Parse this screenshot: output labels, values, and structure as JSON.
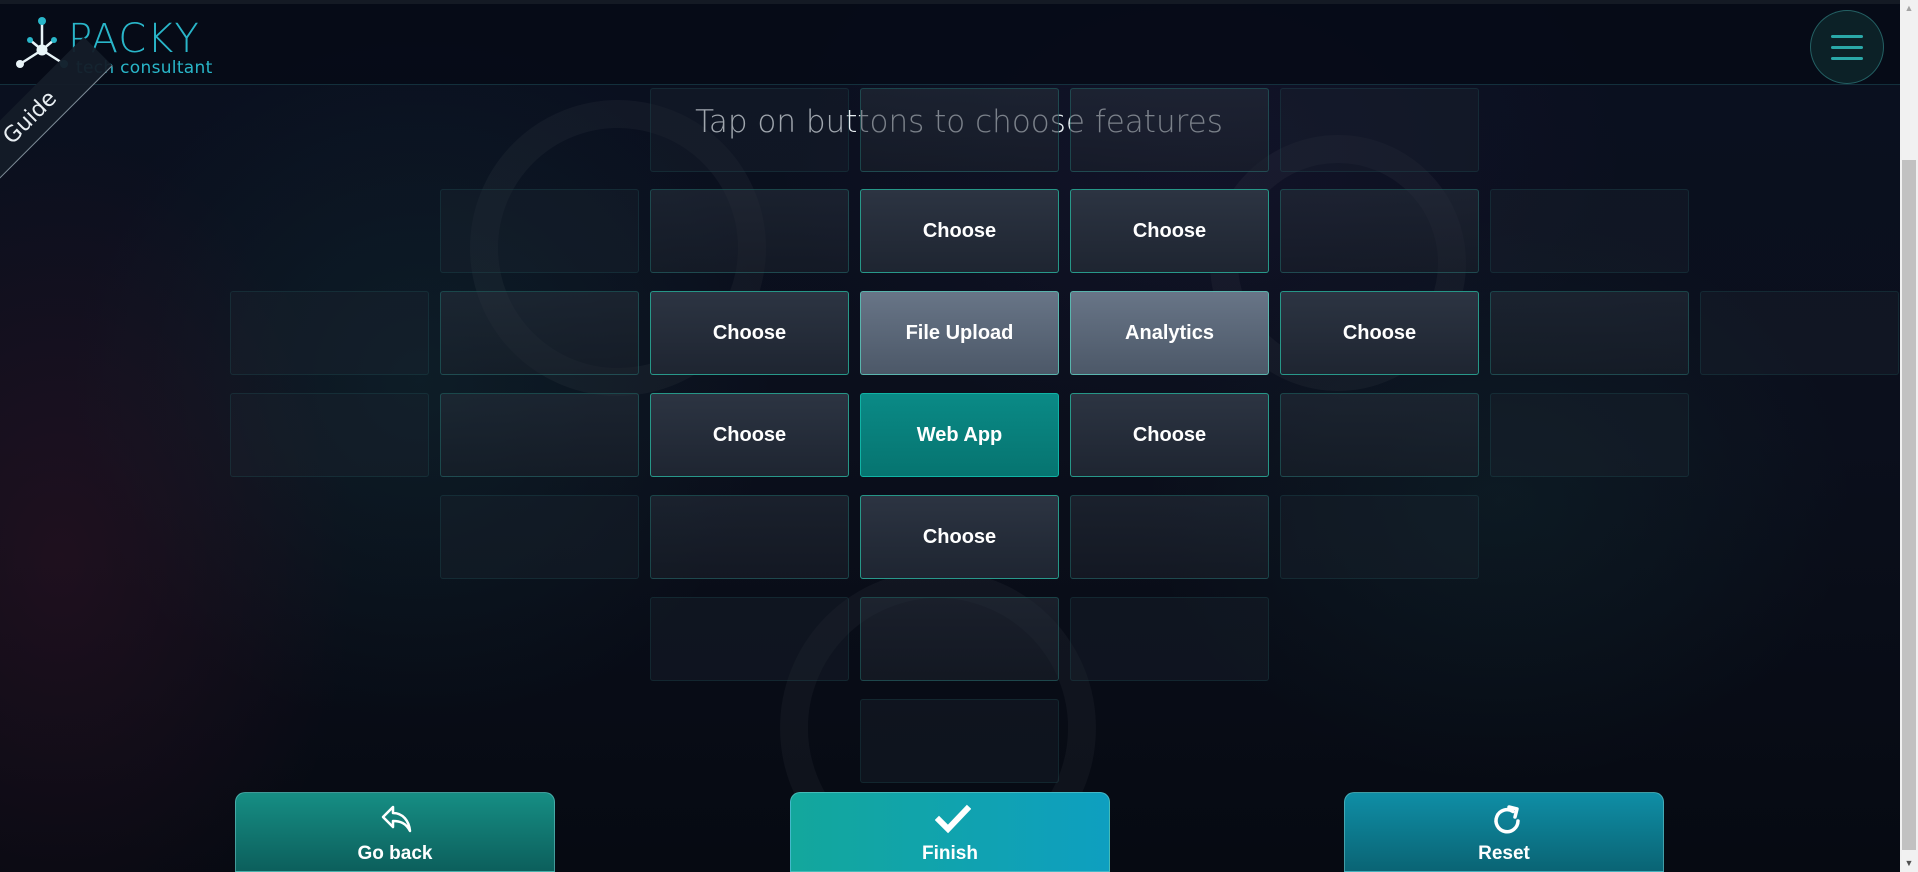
{
  "header": {
    "brand_name": "PACKY",
    "brand_tagline": "tech consultant",
    "logo_icon": "molecule-network-icon",
    "menu_icon": "hamburger-menu-icon"
  },
  "guide": {
    "label": "Guide"
  },
  "title": "Tap on buttons to choose features",
  "grid": {
    "cells": [
      {
        "label": "",
        "style": "faint"
      },
      {
        "label": "",
        "style": "dim"
      },
      {
        "label": "",
        "style": "dim"
      },
      {
        "label": "",
        "style": "faint"
      },
      {
        "label": "",
        "style": "faint"
      },
      {
        "label": "",
        "style": "dim"
      },
      {
        "label": "Choose",
        "style": "normal"
      },
      {
        "label": "Choose",
        "style": "normal"
      },
      {
        "label": "",
        "style": "dim"
      },
      {
        "label": "",
        "style": "faint"
      },
      {
        "label": "",
        "style": "faint"
      },
      {
        "label": "",
        "style": "dim"
      },
      {
        "label": "Choose",
        "style": "normal"
      },
      {
        "label": "File Upload",
        "style": "light"
      },
      {
        "label": "Analytics",
        "style": "light"
      },
      {
        "label": "Choose",
        "style": "normal"
      },
      {
        "label": "",
        "style": "dim"
      },
      {
        "label": "",
        "style": "faint"
      },
      {
        "label": "",
        "style": "faint"
      },
      {
        "label": "",
        "style": "dim"
      },
      {
        "label": "Choose",
        "style": "normal"
      },
      {
        "label": "Web App",
        "style": "selected"
      },
      {
        "label": "Choose",
        "style": "normal"
      },
      {
        "label": "",
        "style": "dim"
      },
      {
        "label": "",
        "style": "faint"
      },
      {
        "label": "",
        "style": "faint"
      },
      {
        "label": "",
        "style": "dim"
      },
      {
        "label": "Choose",
        "style": "normal"
      },
      {
        "label": "",
        "style": "dim"
      },
      {
        "label": "",
        "style": "faint"
      },
      {
        "label": "",
        "style": "faint"
      },
      {
        "label": "",
        "style": "dim"
      },
      {
        "label": "",
        "style": "faint"
      },
      {
        "label": "",
        "style": "faint"
      }
    ]
  },
  "footer": {
    "go_back": {
      "label": "Go back",
      "icon": "reply-arrow-icon"
    },
    "finish": {
      "label": "Finish",
      "icon": "checkmark-icon"
    },
    "reset": {
      "label": "Reset",
      "icon": "refresh-icon"
    }
  },
  "colors": {
    "accent": "#29b6c9",
    "selected": "#0a8a86",
    "cell_border": "#28aa96"
  }
}
